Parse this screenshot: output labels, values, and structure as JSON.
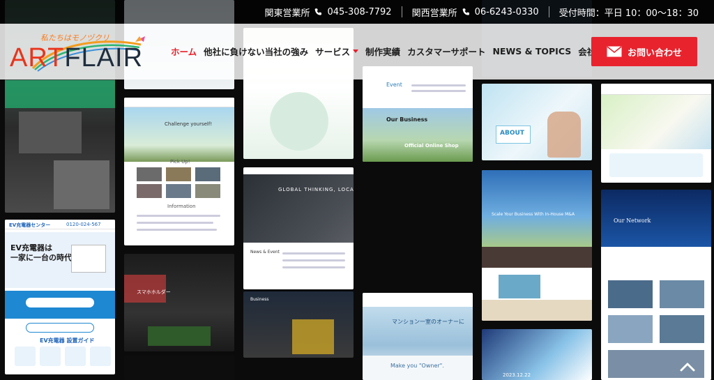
{
  "topbar": {
    "kanto_label": "関東営業所",
    "kanto_phone": "045-308-7792",
    "kansai_label": "関西営業所",
    "kansai_phone": "06-6243-0330",
    "hours": "受付時間：平日 10：00〜18：30",
    "phone_icon": "phone-icon"
  },
  "logo": {
    "tagline": "私たちはモノヅクリ",
    "art": "ART",
    "flair": "FLAIR"
  },
  "nav": {
    "items": [
      {
        "label": "ホーム",
        "active": true
      },
      {
        "label": "他社に負けない当社の強み"
      },
      {
        "label": "サービス",
        "has_dropdown": true
      },
      {
        "label": "制作実績"
      },
      {
        "label": "カスタマーサポート"
      },
      {
        "label": "NEWS & TOPICS"
      },
      {
        "label": "会社案内"
      }
    ]
  },
  "contact_button": {
    "label": "お問い合わせ",
    "icon": "mail-icon"
  },
  "colors": {
    "accent": "#e8232e",
    "logo_art": "#e8341c",
    "logo_flair": "#1f2d3d"
  },
  "thumbnails": {
    "ev_title": "EV充電器は\n一家に一台の時代へ",
    "ev_center": "EV充電器センター",
    "ev_phone": "0120-024-567",
    "ev_guide": "EV充電器 設置ガイド",
    "pickup": "Pick Up!",
    "information": "Information",
    "challenge": "Challenge yourself!",
    "global": "GLOBAL THINKING, LOCAL TOUCH",
    "news_event": "News & Event",
    "business": "Business",
    "event": "Event",
    "our_business": "Our Business",
    "official_shop": "Official Online Shop",
    "about": "ABOUT",
    "scale": "Scale Your Business With In-House M&A",
    "our_network": "Our Network",
    "mansion": "マンション一室のオーナーに",
    "make_you": "Make you \"Owner\".",
    "smartphone": "スマホホルダー",
    "date": "2023.12.22"
  },
  "scroll_top_icon": "chevron-up-icon"
}
